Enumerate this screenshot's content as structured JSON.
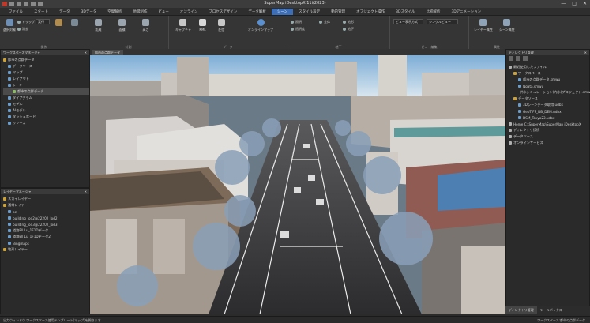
{
  "window": {
    "title": "SuperMap iDesktopX 11i(2023)",
    "controls": [
      "—",
      "□",
      "✕"
    ]
  },
  "menu": {
    "tabs": [
      "ファイル",
      "スタート",
      "データ",
      "3Dデータ",
      "空間解析",
      "地図制作",
      "ビュー",
      "オンライン",
      "プロセスデザイン",
      "データ解析",
      "シーン",
      "スタイル設定",
      "動的管理",
      "オブジェクト操作",
      "3Dスタイル",
      "比較解析",
      "3Dアニメーション"
    ],
    "active_index": 10
  },
  "ribbon": {
    "groups": [
      {
        "label": "操作"
      },
      {
        "label": "計測"
      },
      {
        "label": "データ"
      },
      {
        "label": "地下"
      },
      {
        "label": "ビュー編集"
      },
      {
        "label": "属性"
      }
    ],
    "buttons": {
      "select": "選択対象",
      "drag": "ドラッグ",
      "clear": "消去",
      "distance": "距離",
      "area": "面積",
      "height": "高さ",
      "capture": "キャプチャ",
      "kml": "KML",
      "stream": "配信",
      "online": "オンラインマップ",
      "layer_attr": "レイヤー属性",
      "scene_attr": "シーン属性"
    },
    "small": {
      "lighting": "照明",
      "fog": "全体",
      "terrain": "地形",
      "transparency": "透明度",
      "underground": "地下"
    },
    "selects": {
      "mode1": "実行",
      "mode2": "ビュー表示方式",
      "mode3": "シングルビュー"
    }
  },
  "workspace_panel": {
    "title": "ワークスペースマネージャ",
    "items": [
      {
        "label": "都市の点群データ",
        "level": 0
      },
      {
        "label": "データソース",
        "level": 1
      },
      {
        "label": "マップ",
        "level": 1
      },
      {
        "label": "レイアウト",
        "level": 1
      },
      {
        "label": "シーン",
        "level": 1
      },
      {
        "label": "都市の点群データ",
        "level": 2
      },
      {
        "label": "ダイアグラム",
        "level": 1
      },
      {
        "label": "モデル",
        "level": 1
      },
      {
        "label": "AIモデル",
        "level": 1
      },
      {
        "label": "ダッシュボード",
        "level": 1
      },
      {
        "label": "リソース",
        "level": 1
      }
    ],
    "selected_index": 5
  },
  "layer_panel": {
    "title": "レイヤーマネージャ",
    "items": [
      {
        "label": "スカイレイヤー",
        "level": 0
      },
      {
        "label": "通常レイヤー",
        "level": 0
      },
      {
        "label": "pc",
        "level": 1
      },
      {
        "label": "building_lod2@22202_lod2",
        "level": 1
      },
      {
        "label": "building_lod3@22202_lod3",
        "level": 1
      },
      {
        "label": "道路Ell Lu_1F1Dデータ",
        "level": 1
      },
      {
        "label": "道路Ell Lu_1F1Dデータ2",
        "level": 1
      },
      {
        "label": "Bingmaps",
        "level": 1
      },
      {
        "label": "地形レイヤー",
        "level": 0
      }
    ]
  },
  "viewport": {
    "tab_label": "都市の点群データ"
  },
  "right_panel": {
    "title": "ディレクトリ管理",
    "items": [
      {
        "label": "最近使用したファイル",
        "level": 0
      },
      {
        "label": "ワークスペース",
        "level": 1
      },
      {
        "label": "都市の点群データ.smwu",
        "level": 2
      },
      {
        "label": "Ngata.smwu",
        "level": 2
      },
      {
        "label": "洪水シミュレーション(内水)プロジェクト.smwu",
        "level": 2
      },
      {
        "label": "データソース",
        "level": 1
      },
      {
        "label": "3Dシーンデータ取得.udbx",
        "level": 2
      },
      {
        "label": "GeoTIFF_DB_DEM.udbx",
        "level": 2
      },
      {
        "label": "DSM_Tokyo23.udbx",
        "level": 2
      },
      {
        "label": "Home C:\\SuperMap\\SuperMap iDesktopX",
        "level": 0
      },
      {
        "label": "ディレクトリ接続",
        "level": 0
      },
      {
        "label": "データベース",
        "level": 0
      },
      {
        "label": "オンラインサービス",
        "level": 0
      }
    ],
    "bottom_tabs": [
      "ディレクトリ管理",
      "ツールボックス"
    ]
  },
  "status": {
    "left": "出力ウィンドウ    ワークスペース使用テンプレート(マップ)を開きます",
    "right": "ワークスペース:都市の点群データ"
  },
  "colors": {
    "accent": "#3d6fb8",
    "sky": "#a8c7e0",
    "road": "#3c3c3e"
  }
}
